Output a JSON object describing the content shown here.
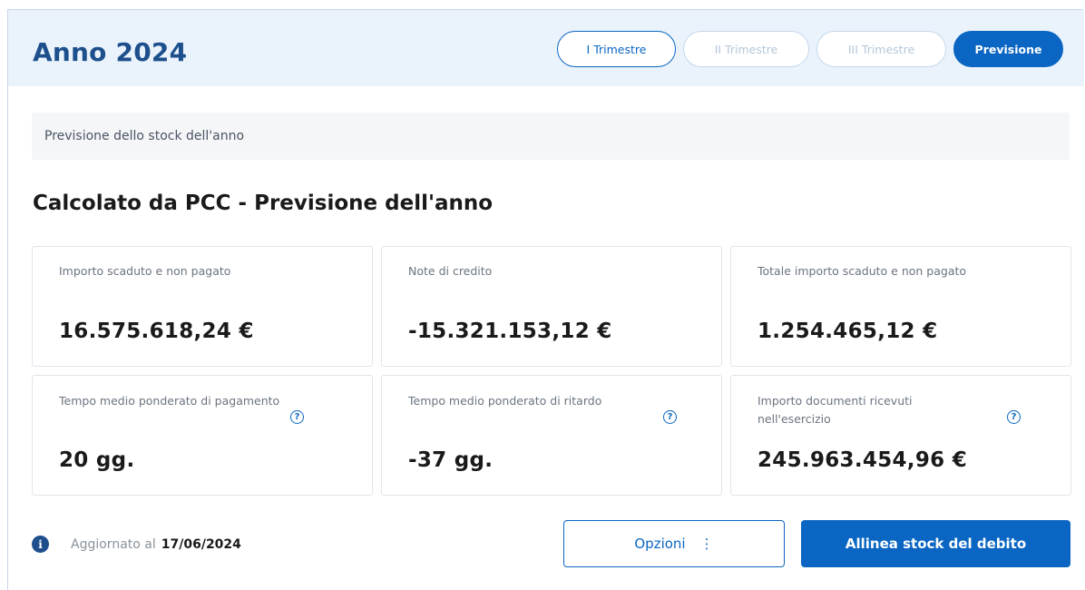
{
  "header": {
    "title": "Anno 2024",
    "tabs": [
      {
        "label": "I Trimestre",
        "state": "outlined"
      },
      {
        "label": "II Trimestre",
        "state": "disabled"
      },
      {
        "label": "III Trimestre",
        "state": "disabled"
      },
      {
        "label": "Previsione",
        "state": "active"
      }
    ]
  },
  "info_bar": {
    "text": "Previsione dello stock dell'anno"
  },
  "section": {
    "title": "Calcolato da PCC - Previsione dell'anno"
  },
  "metrics": [
    {
      "label": "Importo scaduto e non pagato",
      "value": "16.575.618,24 €"
    },
    {
      "label": "Note di credito",
      "value": "-15.321.153,12 €"
    },
    {
      "label": "Totale importo scaduto e non pagato",
      "value": "1.254.465,12 €"
    },
    {
      "label": "Tempo medio ponderato di pagamento",
      "value": "20 gg.",
      "help_icon": "question-circle-icon"
    },
    {
      "label": "Tempo medio ponderato di ritardo",
      "value": "-37 gg.",
      "help_icon": "question-circle-icon"
    },
    {
      "label": "Importo documenti ricevuti nell'esercizio",
      "value": "245.963.454,96 €",
      "help_icon": "question-circle-icon"
    }
  ],
  "footer": {
    "info_icon": "info-circle-icon",
    "updated_label": "Aggiornato al",
    "updated_date": "17/06/2024",
    "options_label": "Opzioni",
    "options_icon": "kebab-menu-icon",
    "primary_label": "Allinea stock del debito"
  },
  "colors": {
    "accent": "#0a66c2",
    "title": "#1d4f8c",
    "header_bg": "#eaf3fc"
  }
}
